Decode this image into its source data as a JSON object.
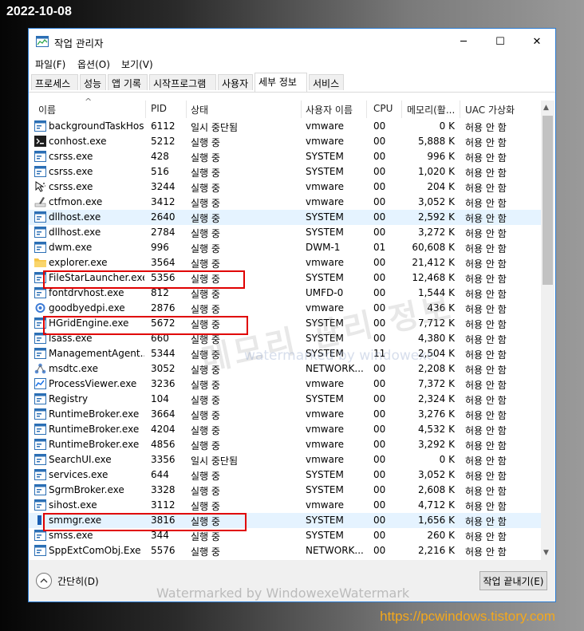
{
  "date_stamp": "2022-10-08",
  "site_url": "https://pcwindows.tistory.com",
  "window": {
    "title": "작업 관리자",
    "minimize": "─",
    "maximize": "☐",
    "close": "✕"
  },
  "menu": [
    "파일(F)",
    "옵션(O)",
    "보기(V)"
  ],
  "tabs": [
    "프로세스",
    "성능",
    "앱 기록",
    "시작프로그램",
    "사용자",
    "세부 정보",
    "서비스"
  ],
  "columns": [
    "이름",
    "PID",
    "상태",
    "사용자 이름",
    "CPU",
    "메모리(활...",
    "UAC 가상화"
  ],
  "sort_indicator": "^",
  "processes": [
    {
      "name": "backgroundTaskHos...",
      "pid": "6112",
      "status": "일시 중단됨",
      "user": "vmware",
      "cpu": "00",
      "mem": "0 K",
      "uac": "허용 안 함",
      "icon": "app-icon"
    },
    {
      "name": "conhost.exe",
      "pid": "5212",
      "status": "실행 중",
      "user": "vmware",
      "cpu": "00",
      "mem": "5,888 K",
      "uac": "허용 안 함",
      "icon": "console-icon"
    },
    {
      "name": "csrss.exe",
      "pid": "428",
      "status": "실행 중",
      "user": "SYSTEM",
      "cpu": "00",
      "mem": "996 K",
      "uac": "허용 안 함",
      "icon": "app-icon"
    },
    {
      "name": "csrss.exe",
      "pid": "516",
      "status": "실행 중",
      "user": "SYSTEM",
      "cpu": "00",
      "mem": "1,020 K",
      "uac": "허용 안 함",
      "icon": "app-icon"
    },
    {
      "name": "csrss.exe",
      "pid": "3244",
      "status": "실행 중",
      "user": "vmware",
      "cpu": "00",
      "mem": "204 K",
      "uac": "허용 안 함",
      "icon": "busy-cursor-icon"
    },
    {
      "name": "ctfmon.exe",
      "pid": "3412",
      "status": "실행 중",
      "user": "vmware",
      "cpu": "00",
      "mem": "3,052 K",
      "uac": "허용 안 함",
      "icon": "pen-icon"
    },
    {
      "name": "dllhost.exe",
      "pid": "2640",
      "status": "실행 중",
      "user": "SYSTEM",
      "cpu": "00",
      "mem": "2,592 K",
      "uac": "허용 안 함",
      "icon": "app-icon"
    },
    {
      "name": "dllhost.exe",
      "pid": "2784",
      "status": "실행 중",
      "user": "SYSTEM",
      "cpu": "00",
      "mem": "3,272 K",
      "uac": "허용 안 함",
      "icon": "app-icon"
    },
    {
      "name": "dwm.exe",
      "pid": "996",
      "status": "실행 중",
      "user": "DWM-1",
      "cpu": "01",
      "mem": "60,608 K",
      "uac": "허용 안 함",
      "icon": "app-icon"
    },
    {
      "name": "explorer.exe",
      "pid": "3564",
      "status": "실행 중",
      "user": "vmware",
      "cpu": "00",
      "mem": "21,412 K",
      "uac": "허용 안 함",
      "icon": "folder-icon"
    },
    {
      "name": "FileStarLauncher.exe",
      "pid": "5356",
      "status": "실행 중",
      "user": "SYSTEM",
      "cpu": "00",
      "mem": "12,468 K",
      "uac": "허용 안 함",
      "icon": "app-icon"
    },
    {
      "name": "fontdrvhost.exe",
      "pid": "812",
      "status": "실행 중",
      "user": "UMFD-0",
      "cpu": "00",
      "mem": "1,544 K",
      "uac": "허용 안 함",
      "icon": "app-icon"
    },
    {
      "name": "goodbyedpi.exe",
      "pid": "2876",
      "status": "실행 중",
      "user": "vmware",
      "cpu": "00",
      "mem": "436 K",
      "uac": "허용 안 함",
      "icon": "gear-icon"
    },
    {
      "name": "HGridEngine.exe",
      "pid": "5672",
      "status": "실행 중",
      "user": "SYSTEM",
      "cpu": "00",
      "mem": "7,712 K",
      "uac": "허용 안 함",
      "icon": "app-icon"
    },
    {
      "name": "lsass.exe",
      "pid": "660",
      "status": "실행 중",
      "user": "SYSTEM",
      "cpu": "00",
      "mem": "4,380 K",
      "uac": "허용 안 함",
      "icon": "app-icon"
    },
    {
      "name": "ManagementAgent...",
      "pid": "5344",
      "status": "실행 중",
      "user": "SYSTEM",
      "cpu": "11",
      "mem": "2,504 K",
      "uac": "허용 안 함",
      "icon": "app-icon"
    },
    {
      "name": "msdtc.exe",
      "pid": "3052",
      "status": "실행 중",
      "user": "NETWORK...",
      "cpu": "00",
      "mem": "2,208 K",
      "uac": "허용 안 함",
      "icon": "network-icon"
    },
    {
      "name": "ProcessViewer.exe",
      "pid": "3236",
      "status": "실행 중",
      "user": "vmware",
      "cpu": "00",
      "mem": "7,372 K",
      "uac": "허용 안 함",
      "icon": "chart-icon"
    },
    {
      "name": "Registry",
      "pid": "104",
      "status": "실행 중",
      "user": "SYSTEM",
      "cpu": "00",
      "mem": "2,324 K",
      "uac": "허용 안 함",
      "icon": "app-icon"
    },
    {
      "name": "RuntimeBroker.exe",
      "pid": "3664",
      "status": "실행 중",
      "user": "vmware",
      "cpu": "00",
      "mem": "3,276 K",
      "uac": "허용 안 함",
      "icon": "app-icon"
    },
    {
      "name": "RuntimeBroker.exe",
      "pid": "4204",
      "status": "실행 중",
      "user": "vmware",
      "cpu": "00",
      "mem": "4,532 K",
      "uac": "허용 안 함",
      "icon": "app-icon"
    },
    {
      "name": "RuntimeBroker.exe",
      "pid": "4856",
      "status": "실행 중",
      "user": "vmware",
      "cpu": "00",
      "mem": "3,292 K",
      "uac": "허용 안 함",
      "icon": "app-icon"
    },
    {
      "name": "SearchUI.exe",
      "pid": "3356",
      "status": "일시 중단됨",
      "user": "vmware",
      "cpu": "00",
      "mem": "0 K",
      "uac": "허용 안 함",
      "icon": "app-icon"
    },
    {
      "name": "services.exe",
      "pid": "644",
      "status": "실행 중",
      "user": "SYSTEM",
      "cpu": "00",
      "mem": "3,052 K",
      "uac": "허용 안 함",
      "icon": "app-icon"
    },
    {
      "name": "SgrmBroker.exe",
      "pid": "3328",
      "status": "실행 중",
      "user": "SYSTEM",
      "cpu": "00",
      "mem": "2,608 K",
      "uac": "허용 안 함",
      "icon": "app-icon"
    },
    {
      "name": "sihost.exe",
      "pid": "3112",
      "status": "실행 중",
      "user": "vmware",
      "cpu": "00",
      "mem": "4,712 K",
      "uac": "허용 안 함",
      "icon": "app-icon"
    },
    {
      "name": "smmgr.exe",
      "pid": "3816",
      "status": "실행 중",
      "user": "SYSTEM",
      "cpu": "00",
      "mem": "1,656 K",
      "uac": "허용 안 함",
      "icon": "bar-icon"
    },
    {
      "name": "smss.exe",
      "pid": "344",
      "status": "실행 중",
      "user": "SYSTEM",
      "cpu": "00",
      "mem": "260 K",
      "uac": "허용 안 함",
      "icon": "app-icon"
    },
    {
      "name": "SppExtComObj.Exe",
      "pid": "5576",
      "status": "실행 중",
      "user": "NETWORK...",
      "cpu": "00",
      "mem": "2,216 K",
      "uac": "허용 안 함",
      "icon": "app-icon"
    }
  ],
  "selected_rows": [
    6,
    26
  ],
  "footer": {
    "collapse_label": "간단히(D)",
    "end_task_label": "작업 끝내기(E)"
  },
  "watermarks": {
    "large": "메모리 관리 정보",
    "middle": "watermarked by windowexe",
    "bottom": "Watermarked by WindowexeWatermark"
  },
  "colors": {
    "highlight_box": "#e00000",
    "selection": "#e5f3ff",
    "window_border": "#2b7cd3",
    "url_text": "#f4a81c"
  }
}
